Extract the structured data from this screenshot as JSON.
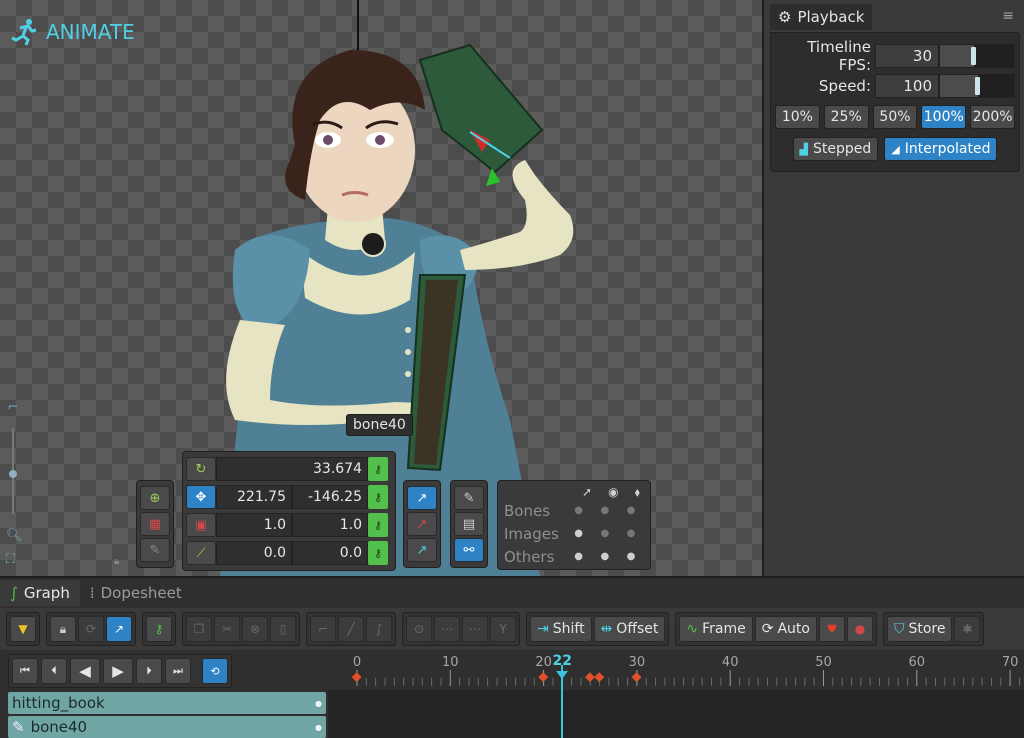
{
  "app": {
    "mode_label": "ANIMATE"
  },
  "viewport": {
    "bone_tooltip": "bone40"
  },
  "transform": {
    "rotate": "33.674",
    "translate_x": "221.75",
    "translate_y": "-146.25",
    "scale_x": "1.0",
    "scale_y": "1.0",
    "shear_x": "0.0",
    "shear_y": "0.0"
  },
  "visibility": {
    "rows": [
      "Bones",
      "Images",
      "Others"
    ]
  },
  "playback": {
    "tab_label": "Playback",
    "fps_label": "Timeline FPS:",
    "fps_value": "30",
    "fps_level": 0.45,
    "speed_label": "Speed:",
    "speed_value": "100",
    "speed_level": 0.5,
    "percent_buttons": [
      "10%",
      "25%",
      "50%",
      "100%",
      "200%"
    ],
    "active_percent": "100%",
    "stepped_label": "Stepped",
    "interpolated_label": "Interpolated",
    "active_mode": "Interpolated"
  },
  "bottom": {
    "tabs": [
      "Graph",
      "Dopesheet"
    ],
    "active_tab": "Graph",
    "shift_label": "Shift",
    "offset_label": "Offset",
    "frame_label": "Frame",
    "auto_label": "Auto",
    "store_label": "Store"
  },
  "timeline": {
    "tick_labels": [
      "0",
      "10",
      "20",
      "30",
      "40",
      "50",
      "60",
      "70"
    ],
    "current_frame": "22",
    "keyframes": [
      0,
      20,
      25,
      26,
      30
    ],
    "tracks": [
      "hitting_book",
      "bone40"
    ]
  },
  "colors": {
    "accent": "#2d83c5",
    "brand": "#4fd0e6",
    "key_green": "#52c04a",
    "keyframe": "#e0502a",
    "track": "#6fa6a3"
  }
}
